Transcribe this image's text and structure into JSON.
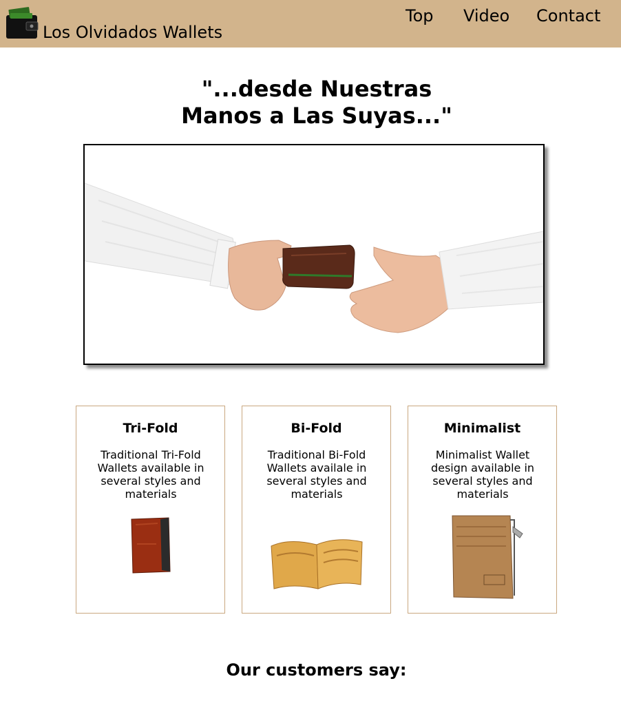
{
  "header": {
    "brand": "Los Olvidados Wallets",
    "logo_icon": "wallet-icon",
    "nav": [
      "Top",
      "Video",
      "Contact"
    ]
  },
  "colors": {
    "header_bg": "#d2b48c",
    "card_border": "#c9a77f"
  },
  "hero": {
    "tagline_line1": "\"...desde Nuestras",
    "tagline_line2": "Manos a Las Suyas...\"",
    "image": "hands-exchanging-wallet-photo"
  },
  "products": [
    {
      "title": "Tri-Fold",
      "description": "Traditional Tri-Fold Wallets available in several styles and materials",
      "image": "trifold-wallet-photo"
    },
    {
      "title": "Bi-Fold",
      "description": "Traditional Bi-Fold Wallets availale in several styles and materials",
      "image": "bifold-wallet-photo"
    },
    {
      "title": "Minimalist",
      "description": "Minimalist Wallet design available in several styles and materials",
      "image": "minimalist-wallet-photo"
    }
  ],
  "testimonials": {
    "heading": "Our customers say:"
  }
}
